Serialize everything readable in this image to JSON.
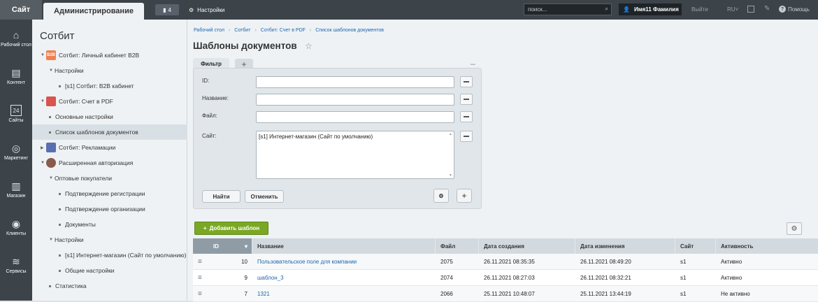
{
  "topbar": {
    "site_tab": "Сайт",
    "admin_tab": "Администрирование",
    "notifications_count": "4",
    "settings_label": "Настройки",
    "search_placeholder": "поиск...",
    "user_name": "Имя11 Фамилия",
    "exit_label": "Выйти",
    "lang_label": "RU",
    "help_label": "Помощь"
  },
  "leftbar": {
    "items": [
      {
        "label": "Рабочий стол",
        "icon": "home-icon"
      },
      {
        "label": "Контент",
        "icon": "document-icon"
      },
      {
        "label": "Сайты",
        "icon": "calendar-icon",
        "glyph": "24"
      },
      {
        "label": "Маркетинг",
        "icon": "target-icon"
      },
      {
        "label": "Магазин",
        "icon": "cart-icon"
      },
      {
        "label": "Клиенты",
        "icon": "clients-icon"
      },
      {
        "label": "Сервисы",
        "icon": "layers-icon"
      }
    ]
  },
  "tree": {
    "title": "Сотбит",
    "items": [
      {
        "label": "Сотбит: Личный кабинет B2B",
        "mod": "B2B"
      },
      {
        "label": "Настройки"
      },
      {
        "label": "[s1] Сотбит: B2B кабинет"
      },
      {
        "label": "Сотбит: Счет в PDF"
      },
      {
        "label": "Основные настройки"
      },
      {
        "label": "Список шаблонов документов"
      },
      {
        "label": "Сотбит: Рекламации"
      },
      {
        "label": "Расширенная авторизация"
      },
      {
        "label": "Оптовые покупатели"
      },
      {
        "label": "Подтверждение регистрации"
      },
      {
        "label": "Подтверждение организации"
      },
      {
        "label": "Документы"
      },
      {
        "label": "Настройки"
      },
      {
        "label": "[s1] Интернет-магазин (Сайт по умолчанию)"
      },
      {
        "label": "Общие настройки"
      },
      {
        "label": "Статистика"
      }
    ]
  },
  "breadcrumb": [
    "Рабочий стол",
    "Сотбит",
    "Сотбит: Счет в PDF",
    "Список шаблонов документов"
  ],
  "page_title": "Шаблоны документов",
  "filter": {
    "tab_label": "Фильтр",
    "add_tab": "+",
    "minimize": "–",
    "fields": [
      {
        "label": "ID:",
        "value": ""
      },
      {
        "label": "Название:",
        "value": ""
      },
      {
        "label": "Файл:",
        "value": ""
      },
      {
        "label": "Сайт:",
        "value": "[s1] Интернет-магазин (Сайт по умолчанию)"
      }
    ],
    "find_button": "Найти",
    "cancel_button": "Отменить",
    "plus_button": "+"
  },
  "add_template_button": "Добавить шаблон",
  "table": {
    "headers": [
      "ID",
      "Название",
      "Файл",
      "Дата создания",
      "Дата изменения",
      "Сайт",
      "Активность"
    ],
    "rows": [
      {
        "id": "10",
        "name": "Пользовательское поле для компании",
        "file": "2075",
        "created": "26.11.2021 08:35:35",
        "modified": "26.11.2021 08:49:20",
        "site": "s1",
        "active": "Активно"
      },
      {
        "id": "9",
        "name": "шаблон_3",
        "file": "2074",
        "created": "26.11.2021 08:27:03",
        "modified": "26.11.2021 08:32:21",
        "site": "s1",
        "active": "Активно"
      },
      {
        "id": "7",
        "name": "1321",
        "file": "2066",
        "created": "25.11.2021 10:48:07",
        "modified": "25.11.2021 13:44:19",
        "site": "s1",
        "active": "Не активно"
      }
    ]
  },
  "colors": {
    "topbar": "#3c4349",
    "accent_green": "#7aa824",
    "link": "#2067b0"
  }
}
